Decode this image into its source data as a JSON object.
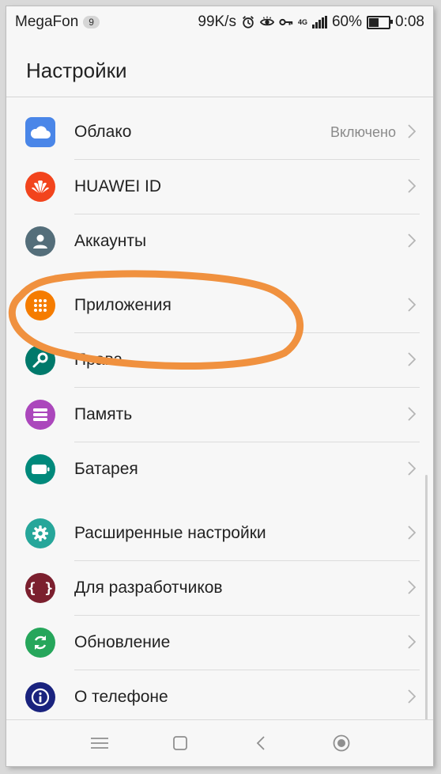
{
  "status_bar": {
    "carrier": "MegaFon",
    "notification_count": "9",
    "speed": "99K/s",
    "network": "4G",
    "battery_percent": "60%",
    "battery_level": 0.6,
    "time": "0:08"
  },
  "header": {
    "title": "Настройки"
  },
  "settings": {
    "cloud": {
      "label": "Облако",
      "value": "Включено",
      "icon": "cloud-icon",
      "color": "#4a86e8"
    },
    "huawei_id": {
      "label": "HUAWEI ID",
      "icon": "huawei-logo-icon",
      "color": "#f2441d"
    },
    "accounts": {
      "label": "Аккаунты",
      "icon": "person-icon",
      "color": "#546e7a"
    },
    "apps": {
      "label": "Приложения",
      "icon": "apps-grid-icon",
      "color": "#f57c00"
    },
    "permissions": {
      "label": "Права",
      "icon": "key-icon",
      "color": "#00796b"
    },
    "memory": {
      "label": "Память",
      "icon": "storage-icon",
      "color": "#ab47bc"
    },
    "battery": {
      "label": "Батарея",
      "icon": "battery-icon",
      "color": "#00897b"
    },
    "advanced": {
      "label": "Расширенные настройки",
      "icon": "gear-icon",
      "color": "#26a69a"
    },
    "developers": {
      "label": "Для разработчиков",
      "icon": "braces-icon",
      "color": "#7b1f2e"
    },
    "update": {
      "label": "Обновление",
      "icon": "refresh-icon",
      "color": "#26a65b"
    },
    "about": {
      "label": "О телефоне",
      "icon": "info-icon",
      "color": "#1a237e"
    }
  },
  "annotation_color": "#f0913f"
}
